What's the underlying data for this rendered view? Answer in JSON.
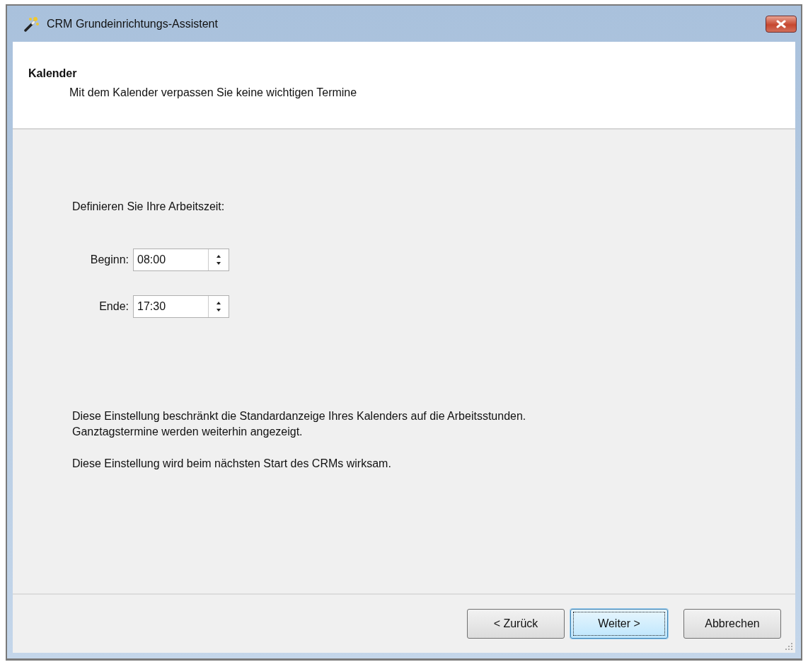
{
  "window": {
    "title": "CRM Grundeinrichtungs-Assistent"
  },
  "header": {
    "title": "Kalender",
    "subtitle": "Mit dem Kalender verpassen Sie keine wichtigen Termine"
  },
  "intro": "Definieren Sie Ihre Arbeitszeit:",
  "fields": [
    {
      "label": "Beginn:",
      "value": "08:00"
    },
    {
      "label": "Ende:",
      "value": "17:30"
    }
  ],
  "notes": [
    "Diese Einstellung beschränkt die Standardanzeige Ihres Kalenders auf die Arbeitsstunden.\nGanztagstermine werden weiterhin angezeigt.",
    "Diese Einstellung wird beim nächsten Start des CRMs wirksam."
  ],
  "buttons": [
    {
      "label": "< Zurück",
      "default": false
    },
    {
      "label": "Weiter >",
      "default": true
    },
    {
      "label": "Abbrechen",
      "default": false
    }
  ]
}
